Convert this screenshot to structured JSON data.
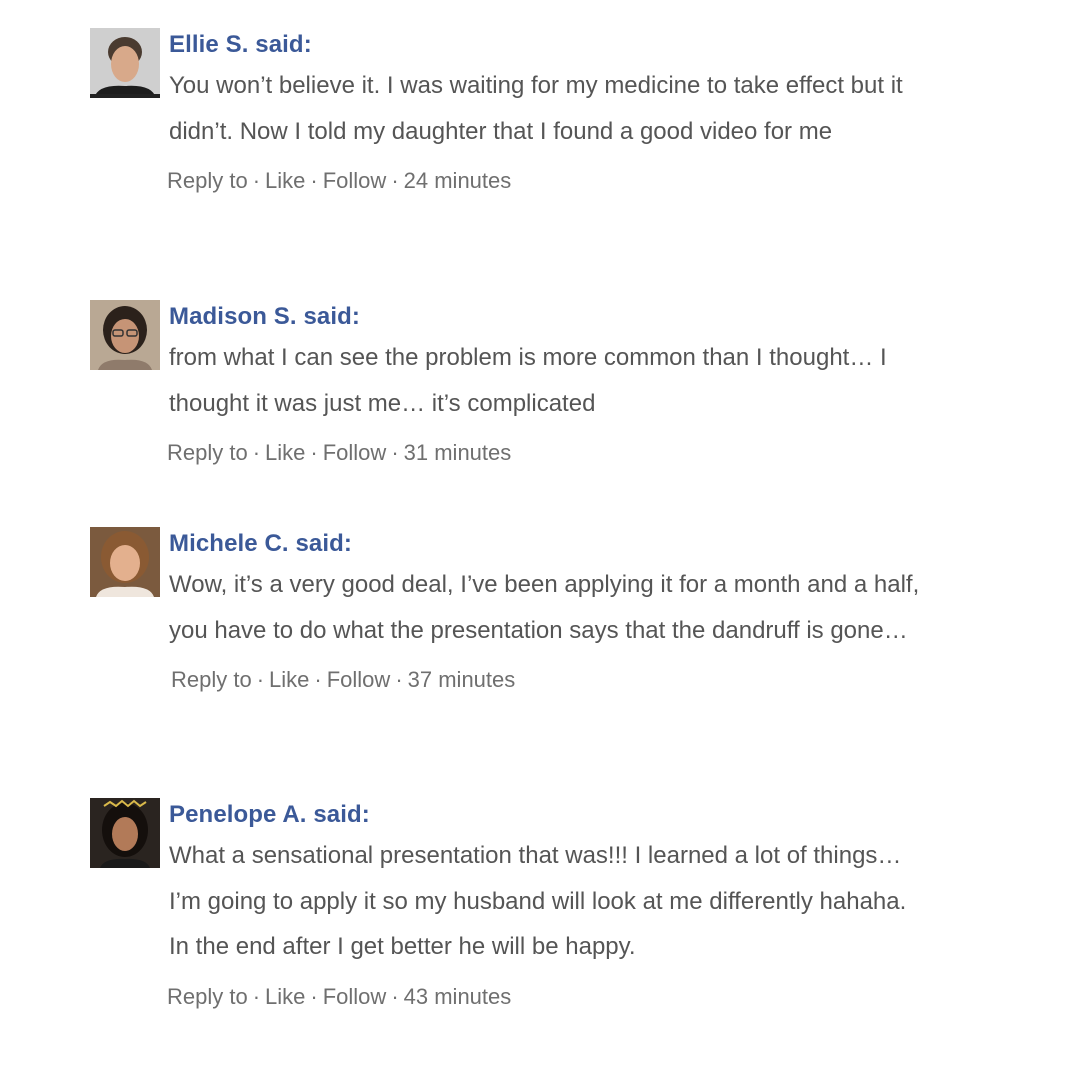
{
  "comments": [
    {
      "author": "Ellie S. said:",
      "text": "You won’t believe it. I was waiting for my medicine to take effect but it didn’t. Now I told my daughter that I found a good video for me",
      "reply": "Reply to",
      "like": "Like",
      "follow": "Follow",
      "time": "24 minutes",
      "avatar_icon": "profile-photo-icon"
    },
    {
      "author": "Madison S. said:",
      "text": "from what I can see the problem is more common than I thought… I thought it was just me… it’s complicated",
      "reply": "Reply to",
      "like": "Like",
      "follow": "Follow",
      "time": "31 minutes",
      "avatar_icon": "profile-photo-icon"
    },
    {
      "author": "Michele C. said:",
      "text": "Wow, it’s a very good deal, I’ve been applying it for a month and a half, you have to do what the presentation says that the dandruff is gone…",
      "reply": "Reply to",
      "like": "Like",
      "follow": "Follow",
      "time": "37 minutes",
      "avatar_icon": "profile-photo-icon"
    },
    {
      "author": "Penelope A. said:",
      "text": "What a sensational presentation that was!!! I learned a lot of things… I’m going to apply it so my husband will look at me differently hahaha. In the end after I get better he will be happy.",
      "reply": "Reply to",
      "like": "Like",
      "follow": "Follow",
      "time": "43 minutes",
      "avatar_icon": "profile-photo-icon"
    }
  ],
  "colors": {
    "author": "#3b5998",
    "text": "#555555",
    "meta": "#6f6f6f"
  }
}
